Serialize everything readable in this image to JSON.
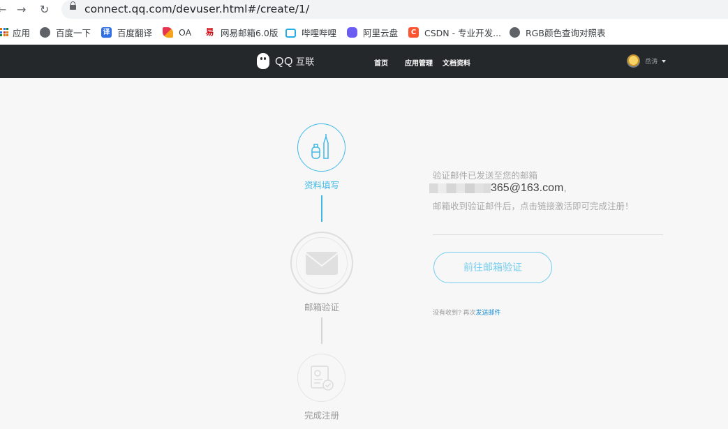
{
  "browser": {
    "url": "connect.qq.com/devuser.html#/create/1/",
    "bookmarks": [
      {
        "label": "应用",
        "icon": "apps-grid-icon"
      },
      {
        "label": "百度一下",
        "icon": "globe-icon"
      },
      {
        "label": "百度翻译",
        "icon": "translate-icon"
      },
      {
        "label": "OA",
        "icon": "oa-icon"
      },
      {
        "label": "网易邮箱6.0版",
        "icon": "netease-mail-icon"
      },
      {
        "label": "哔哩哔哩",
        "icon": "bilibili-icon"
      },
      {
        "label": "阿里云盘",
        "icon": "aliyun-drive-icon"
      },
      {
        "label": "CSDN - 专业开发...",
        "icon": "csdn-icon"
      },
      {
        "label": "RGB颜色查询对照表",
        "icon": "globe-icon"
      }
    ]
  },
  "header": {
    "logo_qq": "QQ",
    "logo_suffix": "互联",
    "nav": [
      "首页",
      "应用管理",
      "文档资料"
    ],
    "username": "岳涛"
  },
  "steps": [
    {
      "label": "资料填写",
      "state": "done",
      "icon": "pen-and-bottle-icon"
    },
    {
      "label": "邮箱验证",
      "state": "current",
      "icon": "envelope-icon"
    },
    {
      "label": "完成注册",
      "state": "pending",
      "icon": "certificate-check-icon"
    }
  ],
  "message": {
    "line1": "验证邮件已发送至您的邮箱",
    "email_visible": "365@163.com",
    "email_trailing": ",",
    "line3": "邮箱收到验证邮件后，点击链接激活即可完成注册！",
    "button": "前往邮箱验证",
    "resend_prefix": "没有收到?  再次",
    "resend_link": "发送邮件"
  },
  "colors": {
    "accent": "#3fb8e6",
    "header_bg": "#25282b",
    "page_bg": "#f7f7f7",
    "link": "#1a8fd6"
  }
}
